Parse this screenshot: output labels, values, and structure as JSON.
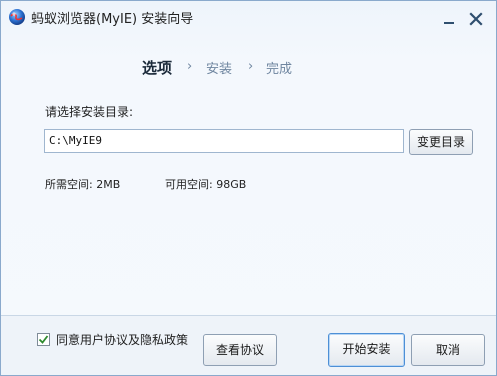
{
  "window": {
    "title": "蚂蚁浏览器(MyIE) 安装向导",
    "icons": {
      "app": "globe-icon",
      "minimize": "minimize-icon",
      "close": "close-icon"
    }
  },
  "steps": {
    "active": "选项",
    "separator": "›",
    "items": [
      "安装",
      "完成"
    ]
  },
  "install_dir": {
    "label": "请选择安装目录:",
    "value": "C:\\MyIE9",
    "browse_label": "变更目录"
  },
  "space": {
    "required": "所需空间: 2MB",
    "available": "可用空间: 98GB"
  },
  "footer": {
    "agree_label": "同意用户协议及隐私政策",
    "agree_checked": true,
    "view_label": "查看协议",
    "install_label": "开始安装",
    "cancel_label": "取消"
  },
  "colors": {
    "accent": "#4d8fd6",
    "check": "#2e8b2e",
    "step_inactive": "#6f86a0"
  }
}
